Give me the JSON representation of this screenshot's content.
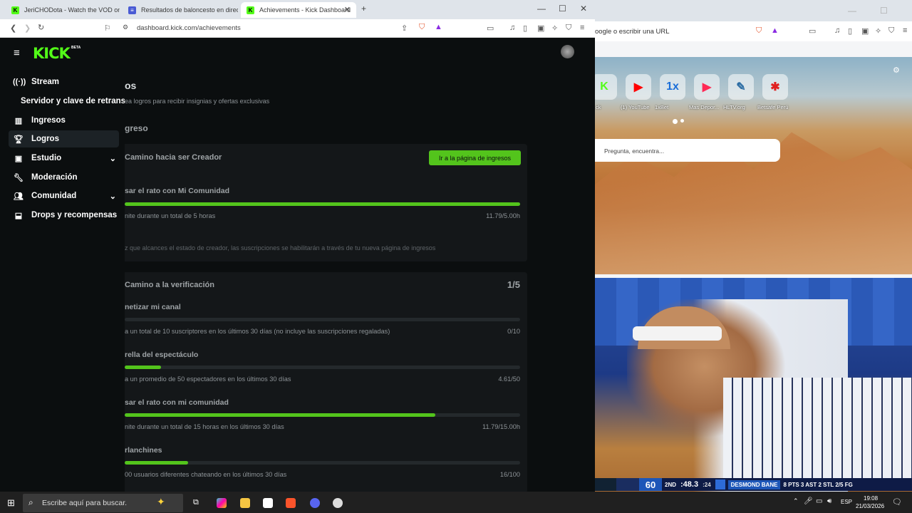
{
  "left_browser": {
    "tabs": [
      {
        "title": "JeriCHODota - Watch the VOD on Ki",
        "active": false
      },
      {
        "title": "Resultados de baloncesto en directo",
        "active": false
      },
      {
        "title": "Achievements - Kick Dashboard",
        "active": true
      }
    ],
    "new_tab": "+",
    "url": "dashboard.kick.com/achievements",
    "window_controls": {
      "minimize": "—",
      "maximize": "☐",
      "close": "✕"
    }
  },
  "kick": {
    "logo": "KICK",
    "beta": "BETA",
    "nav": [
      {
        "label": "Stream",
        "icon": "stream-icon"
      },
      {
        "label": "Servidor y clave de retransm",
        "icon": ""
      },
      {
        "label": "Ingresos",
        "icon": "chart-icon"
      },
      {
        "label": "Logros",
        "icon": "trophy-icon"
      },
      {
        "label": "Estudio",
        "icon": "studio-icon"
      },
      {
        "label": "Moderación",
        "icon": "wrench-icon"
      },
      {
        "label": "Comunidad",
        "icon": "community-icon"
      },
      {
        "label": "Drops y recompensas",
        "icon": "drops-icon"
      }
    ],
    "page": {
      "title_fragment": "os",
      "subtitle": "ea logros para recibir insignias y ofertas exclusivas",
      "section": "greso",
      "creator_card": {
        "title": "Camino hacia ser Creador",
        "button": "Ir a la página de ingresos",
        "task_title": "sar el rato con Mi Comunidad",
        "task_desc": "nite durante un total de 5 horas",
        "task_value": "11.79/5.00h",
        "task_progress": 1.0,
        "note": "z que alcances el estado de creador, las suscripciones se habilitarán a través de tu nueva página de ingresos"
      },
      "verification_card": {
        "title": "Camino a la verificación",
        "count": "1/5",
        "tasks": [
          {
            "title": "netizar mi canal",
            "desc": "a un total de 10 suscriptores en los últimos 30 días (no incluye las suscripciones regaladas)",
            "value": "0/10",
            "progress": 0.0
          },
          {
            "title": "rella del espectáculo",
            "desc": "a un promedio de 50 espectadores en los últimos 30 días",
            "value": "4.61/50",
            "progress": 0.092
          },
          {
            "title": "sar el rato con mi comunidad",
            "desc": "nite durante un total de 15 horas en los últimos 30 días",
            "value": "11.79/15.00h",
            "progress": 0.786
          },
          {
            "title": "rlanchines",
            "desc": "00 usuarios diferentes chateando en los últimos 30 días",
            "value": "16/100",
            "progress": 0.16
          }
        ]
      }
    }
  },
  "right_browser": {
    "address_placeholder": "oogle o escribir una URL",
    "shortcuts": [
      {
        "label": "ck",
        "color": "#53fc18",
        "glyph": "K"
      },
      {
        "label": "(1) YouTube",
        "color": "#ff0000",
        "glyph": "▶"
      },
      {
        "label": "1xBet",
        "color": "#1a6ed8",
        "glyph": "1x"
      },
      {
        "label": "Mas Depor...",
        "color": "#ff2a55",
        "glyph": "▶"
      },
      {
        "label": "HLTV.org",
        "color": "#2b6ca3",
        "glyph": "✎"
      },
      {
        "label": "Betsafe Perú",
        "color": "#e0201f",
        "glyph": "✱"
      }
    ],
    "search_placeholder": "Pregunta, encuentra..."
  },
  "scoreboard": {
    "score": "60",
    "period": "2ND",
    "clock": ":48.3",
    "shot_clock": ":24",
    "player": "DESMOND BANE",
    "stats": "8 PTS 3 AST 2 STL 2/5 FG"
  },
  "taskbar": {
    "search_placeholder": "Escribe aquí para buscar.",
    "language": "ESP",
    "time": "19:08",
    "date": "21/03/2026"
  }
}
